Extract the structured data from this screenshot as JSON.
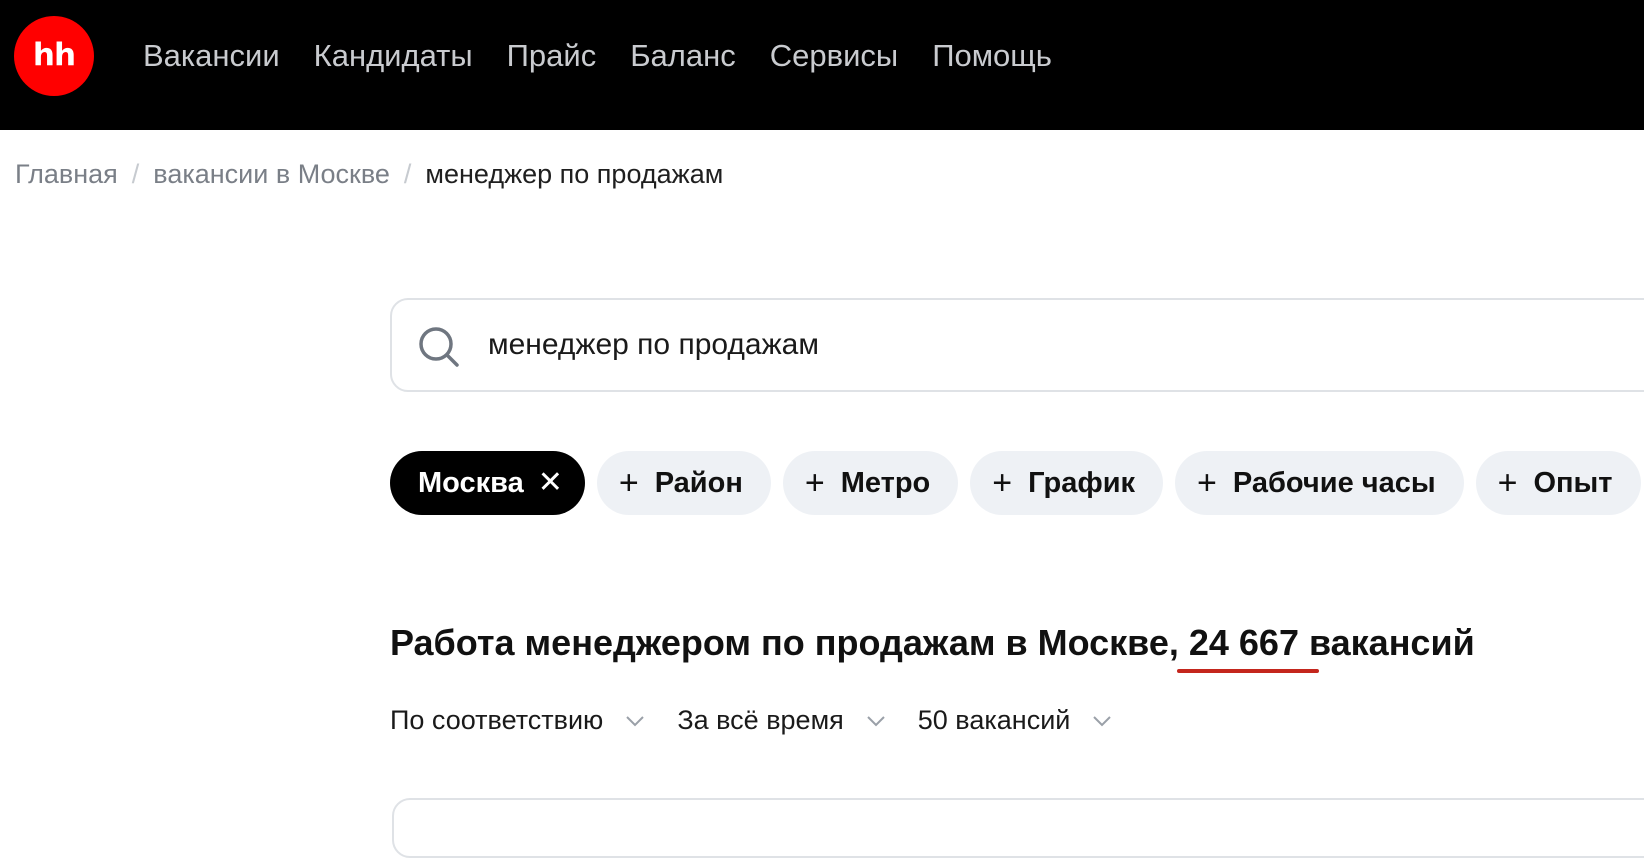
{
  "header": {
    "logo": "hh",
    "nav": [
      {
        "label": "Вакансии"
      },
      {
        "label": "Кандидаты"
      },
      {
        "label": "Прайс"
      },
      {
        "label": "Баланс"
      },
      {
        "label": "Сервисы"
      },
      {
        "label": "Помощь"
      }
    ]
  },
  "breadcrumb": {
    "items": [
      "Главная",
      "вакансии в Москве"
    ],
    "current": "менеджер по продажам",
    "separator": "/"
  },
  "search": {
    "value": "менеджер по продажам",
    "icon": "search-icon"
  },
  "filters": {
    "active": {
      "label": "Москва",
      "icon": "close-icon"
    },
    "chips": [
      {
        "label": "Район",
        "icon": "plus-icon"
      },
      {
        "label": "Метро",
        "icon": "plus-icon"
      },
      {
        "label": "График",
        "icon": "plus-icon"
      },
      {
        "label": "Рабочие часы",
        "icon": "plus-icon"
      },
      {
        "label": "Опыт",
        "icon": "plus-icon"
      }
    ]
  },
  "results": {
    "title_prefix": "Работа менеджером по продажам в Москве, ",
    "count": "24 667",
    "title_suffix": " вакансий"
  },
  "sort": [
    {
      "label": "По соответствию",
      "icon": "chevron-down-icon"
    },
    {
      "label": "За всё время",
      "icon": "chevron-down-icon"
    },
    {
      "label": "50 вакансий",
      "icon": "chevron-down-icon"
    }
  ],
  "colors": {
    "brand": "#ff0000",
    "topbar": "#000000",
    "accent_underline": "#c4261d",
    "chip_bg": "#eef1f5"
  }
}
